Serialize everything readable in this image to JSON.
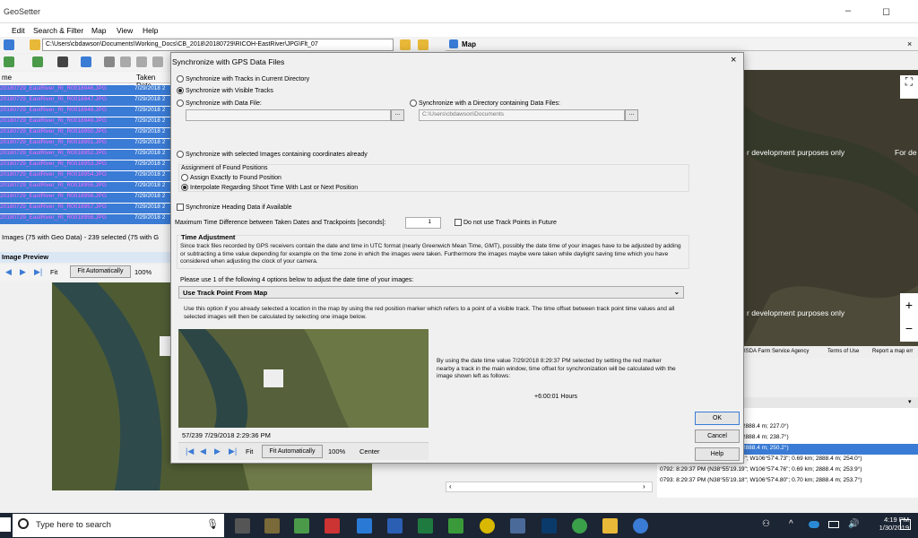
{
  "app": {
    "title": "GeoSetter"
  },
  "menu": [
    "Edit",
    "Search & Filter",
    "Map",
    "View",
    "Help"
  ],
  "toolbar": {
    "path": "C:\\Users\\cbdawson\\Documents\\Working_Docs\\CB_2018\\20180729\\RICOH-EastRiver\\JPG\\Flt_07"
  },
  "list": {
    "col_name": "me",
    "col_date": "Taken Date",
    "rows": [
      {
        "name": "20180729_EastRiver_RI_R0018946.JPG",
        "date": "7/29/2018 2"
      },
      {
        "name": "20180729_EastRiver_RI_R0018947.JPG",
        "date": "7/29/2018 2"
      },
      {
        "name": "20180729_EastRiver_RI_R0018948.JPG",
        "date": "7/29/2018 2"
      },
      {
        "name": "20180729_EastRiver_RI_R0018949.JPG",
        "date": "7/29/2018 2"
      },
      {
        "name": "20180729_EastRiver_RI_R0018950.JPG",
        "date": "7/29/2018 2"
      },
      {
        "name": "20180729_EastRiver_RI_R0018951.JPG",
        "date": "7/29/2018 2"
      },
      {
        "name": "20180729_EastRiver_RI_R0018952.JPG",
        "date": "7/29/2018 2"
      },
      {
        "name": "20180729_EastRiver_RI_R0018953.JPG",
        "date": "7/29/2018 2"
      },
      {
        "name": "20180729_EastRiver_RI_R0018954.JPG",
        "date": "7/29/2018 2"
      },
      {
        "name": "20180729_EastRiver_RI_R0018955.JPG",
        "date": "7/29/2018 2"
      },
      {
        "name": "20180729_EastRiver_RI_R0018956.JPG",
        "date": "7/29/2018 2"
      },
      {
        "name": "20180729_EastRiver_RI_R0018957.JPG",
        "date": "7/29/2018 2"
      },
      {
        "name": "20180729_EastRiver_RI_R0018958.JPG",
        "date": "7/29/2018 2"
      }
    ],
    "status": "Images (75 with Geo Data) - 239 selected (75 with G"
  },
  "image_preview": {
    "title": "Image Preview",
    "fit": "Fit",
    "fit_auto": "Fit Automatically",
    "zoom": "100%"
  },
  "map": {
    "title": "Map",
    "watermark1": "r development purposes only",
    "watermark2": "For de",
    "watermark3": "r development purposes only",
    "strip": [
      "ISDA Farm Service Agency",
      "Terms of Use",
      "Report a map err"
    ]
  },
  "right_list": {
    "rows": [
      "9.20\"; W106°57'4.67\"; 0.69 km; 2888.4 m; 227.0°)",
      "9.20\"; W106°57'4.68\"; 0.69 km; 2888.4 m; 238.7°)",
      "9.19\"; W106°57'4.70\"; 0.69 km; 2888.4 m; 250.2°)",
      "0791: 8:29:37 PM (N38°55'19.19\"; W106°57'4.73\"; 0.69 km; 2888.4 m; 254.0°)",
      "0792: 8:29:37 PM (N38°55'19.19\"; W106°57'4.76\"; 0.69 km; 2888.4 m; 253.9°)",
      "0793: 8:29:37 PM (N38°55'19.18\"; W106°57'4.80\"; 0.70 km; 2888.4 m; 253.7°)"
    ]
  },
  "dialog": {
    "title": "Synchronize with GPS Data Files",
    "opt_tracks_dir": "Synchronize with Tracks in Current Directory",
    "opt_visible": "Synchronize with Visible Tracks",
    "opt_data_file": "Synchronize with Data File:",
    "opt_directory": "Synchronize with a Directory containing Data Files:",
    "dir_value": "C:\\Users\\cbdawson\\Documents",
    "browse": "...",
    "opt_selected_images": "Synchronize with selected Images containing coordinates already",
    "assign_group": "Assignment of Found Positions",
    "assign_exact": "Assign Exactly to Found Position",
    "interpolate": "Interpolate Regarding Shoot Time With Last or Next Position",
    "heading": "Synchronize Heading Data if Available",
    "max_diff_label": "Maximum Time Difference between Taken Dates and Trackpoints [seconds]:",
    "max_diff_value": "1",
    "no_future": "Do not use Track Points in Future",
    "time_adj_title": "Time Adjustment",
    "time_adj_text": "Since track files recorded by GPS receivers contain the date and time in UTC format (nearly Greenwich Mean Time, GMT), possibly the date time of your images have to be adjusted by adding or subtracting a time value depending for example on the time zone in which the images were taken. Furthermore the images maybe were taken while daylight saving time which you have considered when adjusting the clock of your camera.",
    "please_use": "Please use 1 of the following 4 options below to adjust the date time of your images:",
    "select_value": "Use Track Point From Map",
    "option_desc": "Use this option if you already selected a location in the map by using the red position marker which refers to a point of a visible track. The time offset between track point time values and all selected images will then be calculated by selecting one image below.",
    "calc_text": "By using the date time value 7/29/2018 8:29:37 PM selected by setting the red marker nearby a track in the main window, time offset for synchronization will be calculated with the image shown left as follows:",
    "offset": "+6:00:01 Hours",
    "img_caption": "57/239 7/29/2018 2:29:36 PM",
    "fit": "Fit",
    "fit_auto": "Fit Automatically",
    "zoom": "100%",
    "center": "Center",
    "ok": "OK",
    "cancel": "Cancel",
    "help": "Help"
  },
  "taskbar": {
    "search_placeholder": "Type here to search",
    "time": "4:19 PM",
    "date": "1/30/2019"
  }
}
